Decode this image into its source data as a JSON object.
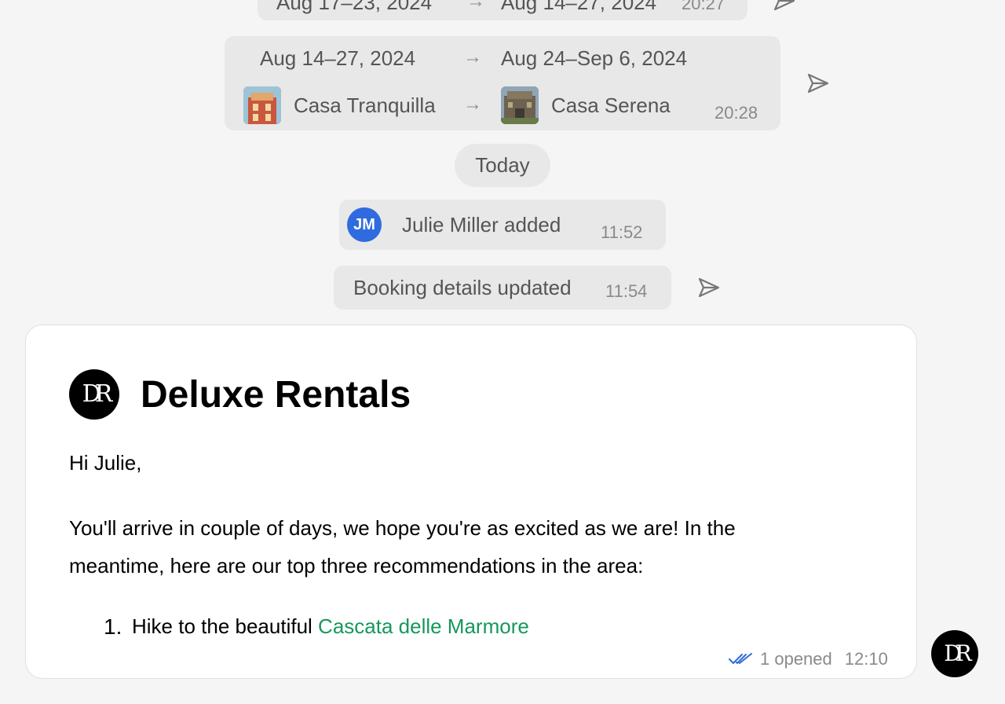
{
  "messages": {
    "top_partial": {
      "from_dates": "Aug 17–23, 2024",
      "to_dates": "Aug 14–27, 2024",
      "time": "20:27"
    },
    "change": {
      "from_dates": "Aug 14–27, 2024",
      "to_dates": "Aug 24–Sep 6, 2024",
      "from_property": "Casa Tranquilla",
      "to_property": "Casa Serena",
      "time": "20:28"
    },
    "day_separator": "Today",
    "added": {
      "avatar_initials": "JM",
      "text": "Julie Miller added",
      "time": "11:52"
    },
    "updated": {
      "text": "Booking details updated",
      "time": "11:54"
    }
  },
  "email": {
    "brand_name": "Deluxe Rentals",
    "logo_initials": "DR",
    "greeting": "Hi Julie,",
    "body": "You'll arrive in couple of days, we hope you're as excited as we are! In the meantime, here are our top three recommendations in the area:",
    "list": [
      {
        "number": "1.",
        "text": "Hike to the beautiful ",
        "link": "Cascata delle Marmore"
      }
    ],
    "opened_text": "1 opened",
    "time": "12:10"
  },
  "sender_avatar_initials": "DR",
  "colors": {
    "background": "#f5f5f5",
    "bubble": "#e8e8e8",
    "avatar_blue": "#2f6bde",
    "link_green": "#15985a",
    "read_check_blue": "#2f6bde"
  },
  "icons": {
    "arrow": "arrow-right-icon",
    "send": "send-icon",
    "read": "double-check-icon"
  }
}
